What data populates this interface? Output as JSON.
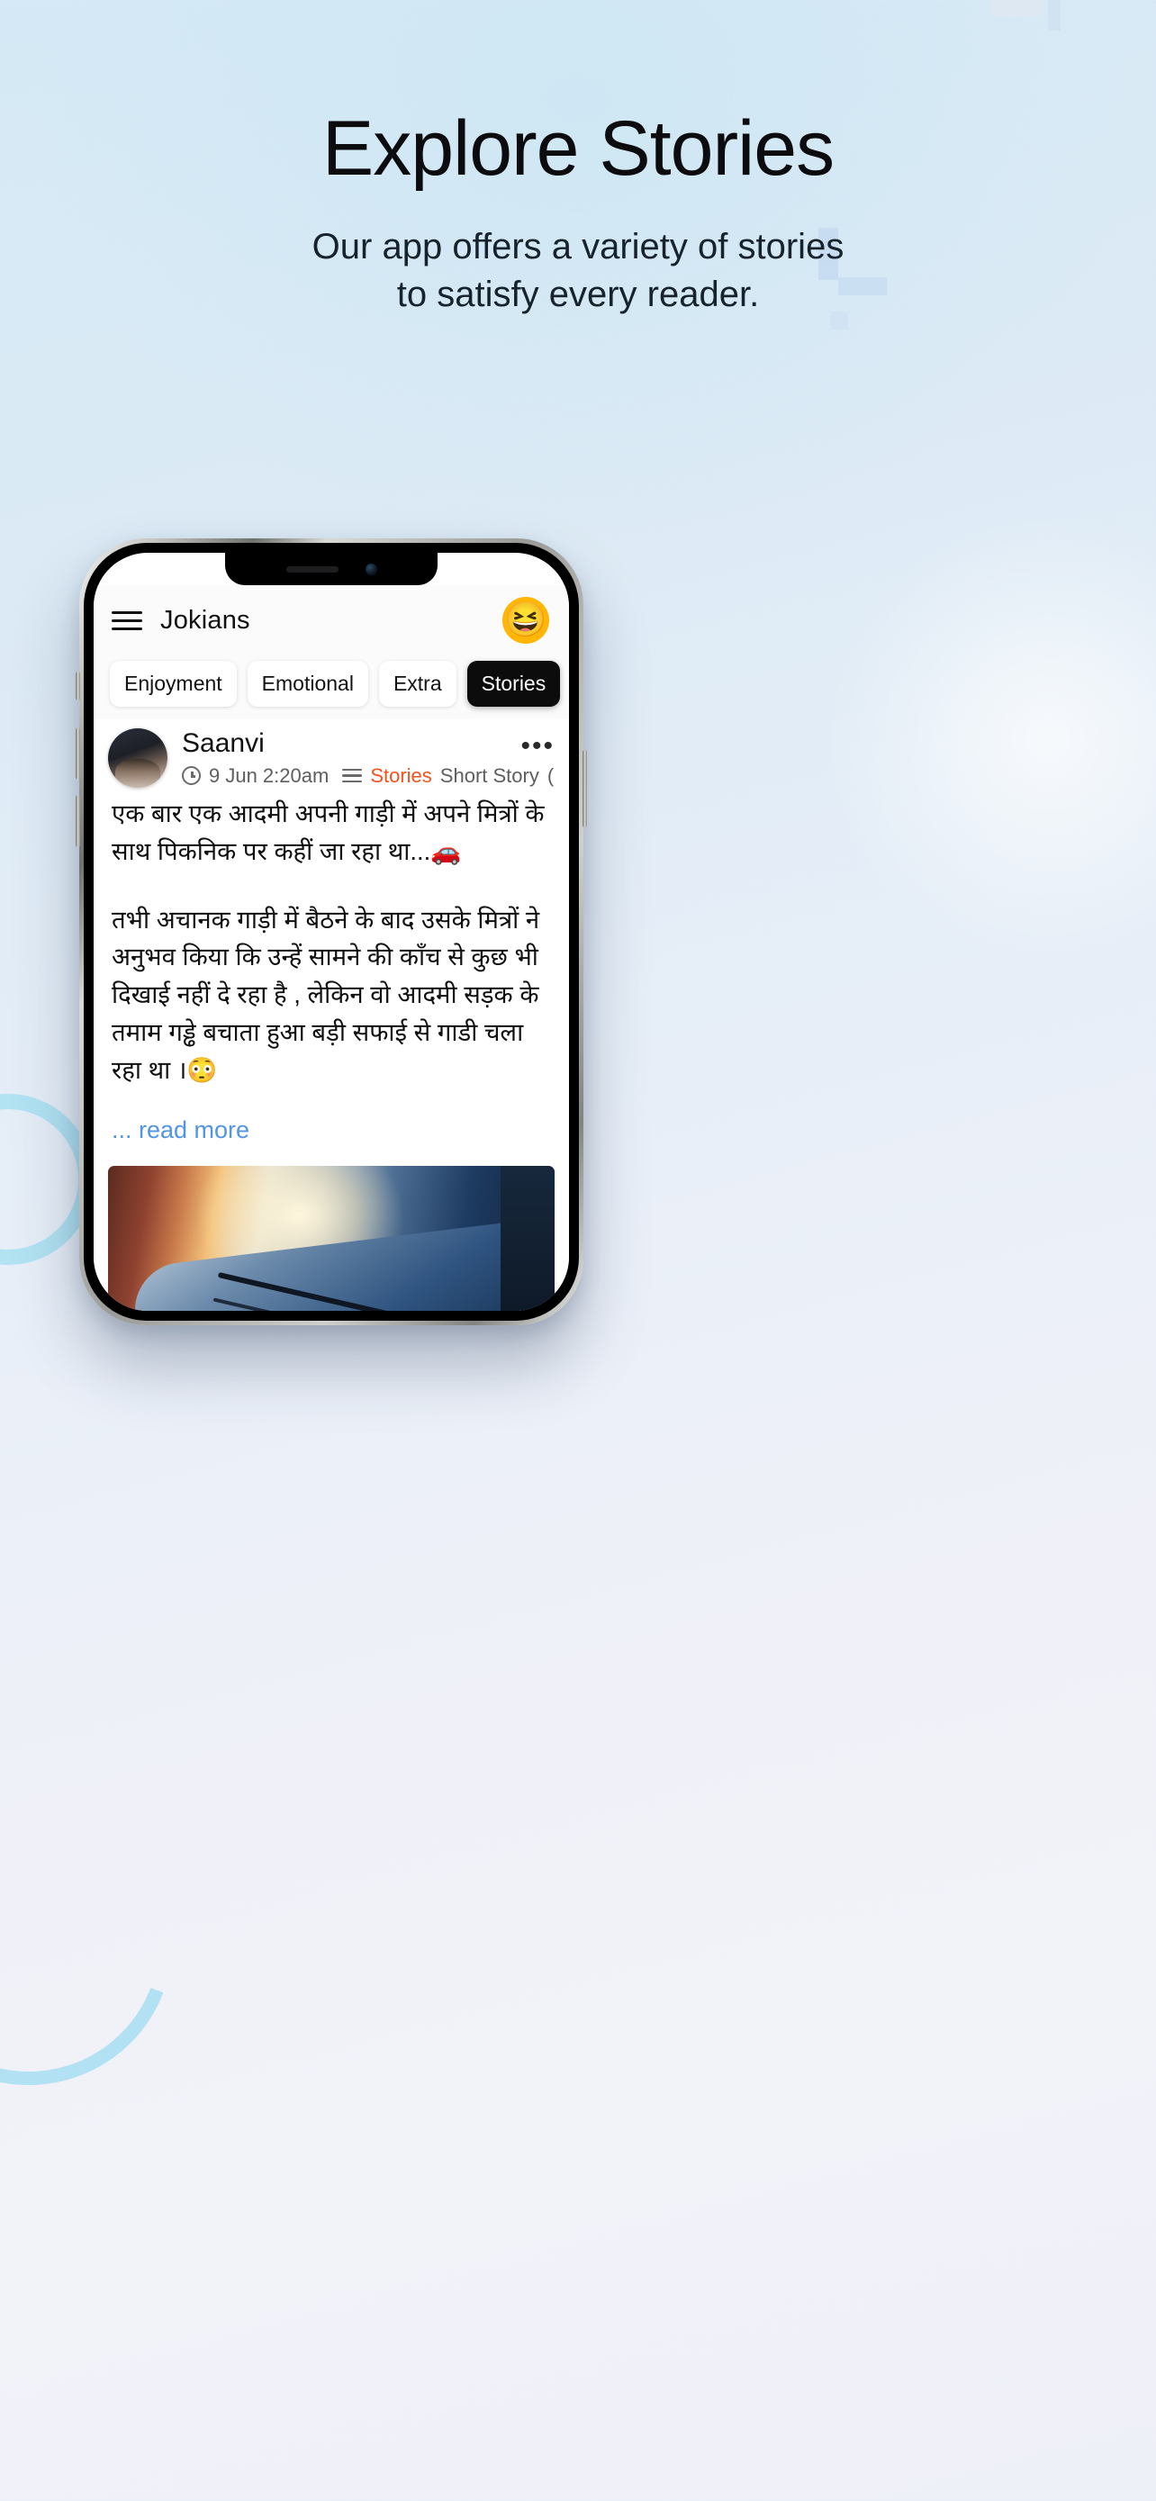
{
  "hero": {
    "title": "Explore Stories",
    "subtitle_line1": "Our app offers a variety of stories",
    "subtitle_line2": "to satisfy every reader."
  },
  "app": {
    "title": "Jokians",
    "menu_icon": "hamburger-menu-icon",
    "avatar_emoji": "😆"
  },
  "tabs": [
    {
      "label": "Enjoyment",
      "active": false
    },
    {
      "label": "Emotional",
      "active": false
    },
    {
      "label": "Extra",
      "active": false
    },
    {
      "label": "Stories",
      "active": true
    }
  ],
  "post": {
    "author": "Saanvi",
    "timestamp": "9 Jun 2:20am",
    "category": "Stories",
    "subcategory": "Short Story",
    "subcategory_extra": "(",
    "more_options": "•••",
    "paragraph1": "एक बार एक आदमी अपनी गाड़ी में अपने मित्रों के साथ पिकनिक पर कहीं जा रहा था...🚗",
    "paragraph2": "तभी अचानक गाड़ी में बैठने के बाद उसके मित्रों ने अनुभव किया कि उन्हें सामने की काँच से कुछ भी दिखाई नहीं दे रहा है , लेकिन वो आदमी सड़क के तमाम गड्ढे बचाता हुआ बड़ी सफाई से गाडी चला रहा था ।😳",
    "read_more": "... read more",
    "image_alt": "car-windshield-photo"
  },
  "actions": [
    {
      "name": "like-button",
      "icon": "thumbs-up-icon"
    },
    {
      "name": "comment-button",
      "icon": "comment-icon"
    },
    {
      "name": "download-button",
      "icon": "cloud-download-icon"
    },
    {
      "name": "share-button",
      "icon": "share-arrow-icon"
    }
  ],
  "bottom_nav": [
    {
      "name": "nav-home",
      "icon": "home-icon",
      "active": true
    },
    {
      "name": "nav-search",
      "icon": "search-icon",
      "active": false
    },
    {
      "name": "nav-create",
      "icon": "plus-icon",
      "active": false
    },
    {
      "name": "nav-premium",
      "icon": "crown-icon",
      "active": false
    },
    {
      "name": "nav-profile",
      "icon": "person-icon",
      "active": false
    }
  ],
  "colors": {
    "accent_orange": "#f56600",
    "category_orange": "#f4511e",
    "link_blue": "#5294e8",
    "active_tab_bg": "#0c0c0c",
    "deco_blue": "#a8e0f2"
  }
}
